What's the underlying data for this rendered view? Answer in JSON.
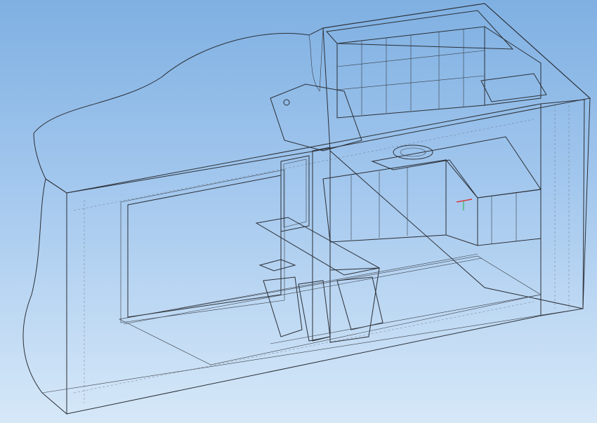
{
  "scene": {
    "background_top": "#7fb0e2",
    "background_bottom": "#d6e8f8",
    "glass_fill": "#8c98a6",
    "solid_fill": "#7c828b",
    "dark_fill": "#3b3f45",
    "highlight_fill": "#cfc62a",
    "edge_color": "#2b2f36",
    "axis_colors": [
      "#e02020",
      "#20b040"
    ]
  }
}
